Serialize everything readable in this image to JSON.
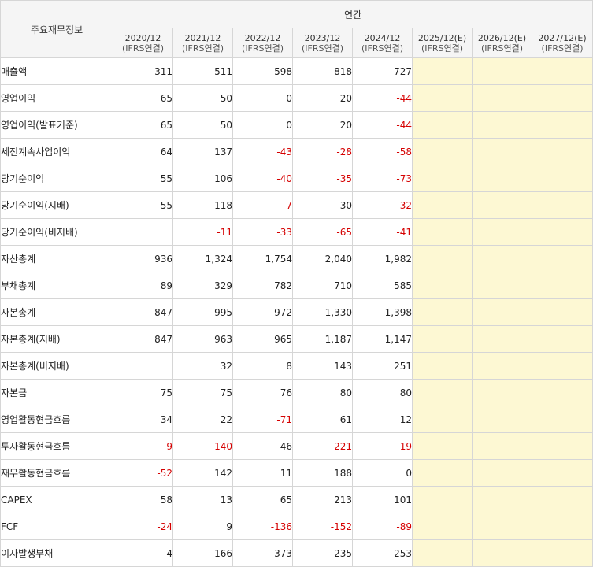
{
  "header": {
    "row_label": "주요재무정보",
    "group_label": "연간",
    "periods": [
      {
        "year": "2020/12",
        "basis": "(IFRS연결)"
      },
      {
        "year": "2021/12",
        "basis": "(IFRS연결)"
      },
      {
        "year": "2022/12",
        "basis": "(IFRS연결)"
      },
      {
        "year": "2023/12",
        "basis": "(IFRS연결)"
      },
      {
        "year": "2024/12",
        "basis": "(IFRS연결)"
      },
      {
        "year": "2025/12(E)",
        "basis": "(IFRS연결)"
      },
      {
        "year": "2026/12(E)",
        "basis": "(IFRS연결)"
      },
      {
        "year": "2027/12(E)",
        "basis": "(IFRS연결)"
      }
    ]
  },
  "rows": [
    {
      "label": "매출액",
      "indent": false,
      "values": [
        "311",
        "511",
        "598",
        "818",
        "727"
      ]
    },
    {
      "label": "영업이익",
      "indent": false,
      "values": [
        "65",
        "50",
        "0",
        "20",
        "-44"
      ]
    },
    {
      "label": "영업이익(발표기준)",
      "indent": false,
      "values": [
        "65",
        "50",
        "0",
        "20",
        "-44"
      ]
    },
    {
      "label": "세전계속사업이익",
      "indent": false,
      "values": [
        "64",
        "137",
        "-43",
        "-28",
        "-58"
      ]
    },
    {
      "label": "당기순이익",
      "indent": false,
      "values": [
        "55",
        "106",
        "-40",
        "-35",
        "-73"
      ]
    },
    {
      "label": "당기순이익(지배)",
      "indent": true,
      "values": [
        "55",
        "118",
        "-7",
        "30",
        "-32"
      ]
    },
    {
      "label": "당기순이익(비지배)",
      "indent": true,
      "values": [
        "",
        "-11",
        "-33",
        "-65",
        "-41"
      ]
    },
    {
      "label": "자산총계",
      "indent": false,
      "values": [
        "936",
        "1,324",
        "1,754",
        "2,040",
        "1,982"
      ]
    },
    {
      "label": "부채총계",
      "indent": false,
      "values": [
        "89",
        "329",
        "782",
        "710",
        "585"
      ]
    },
    {
      "label": "자본총계",
      "indent": false,
      "values": [
        "847",
        "995",
        "972",
        "1,330",
        "1,398"
      ]
    },
    {
      "label": "자본총계(지배)",
      "indent": true,
      "values": [
        "847",
        "963",
        "965",
        "1,187",
        "1,147"
      ]
    },
    {
      "label": "자본총계(비지배)",
      "indent": true,
      "values": [
        "",
        "32",
        "8",
        "143",
        "251"
      ]
    },
    {
      "label": "자본금",
      "indent": false,
      "values": [
        "75",
        "75",
        "76",
        "80",
        "80"
      ]
    },
    {
      "label": "영업활동현금흐름",
      "indent": false,
      "values": [
        "34",
        "22",
        "-71",
        "61",
        "12"
      ]
    },
    {
      "label": "투자활동현금흐름",
      "indent": false,
      "values": [
        "-9",
        "-140",
        "46",
        "-221",
        "-19"
      ]
    },
    {
      "label": "재무활동현금흐름",
      "indent": false,
      "values": [
        "-52",
        "142",
        "11",
        "188",
        "0"
      ]
    },
    {
      "label": "CAPEX",
      "indent": false,
      "values": [
        "58",
        "13",
        "65",
        "213",
        "101"
      ]
    },
    {
      "label": "FCF",
      "indent": false,
      "values": [
        "-24",
        "9",
        "-136",
        "-152",
        "-89"
      ]
    },
    {
      "label": "이자발생부채",
      "indent": false,
      "values": [
        "4",
        "166",
        "373",
        "235",
        "253"
      ]
    }
  ],
  "estimate_columns": 3,
  "colors": {
    "negative": "#d50000",
    "estimate_bg": "#fdf8d3",
    "header_bg": "#f5f5f5",
    "border": "#d6d6d6"
  }
}
